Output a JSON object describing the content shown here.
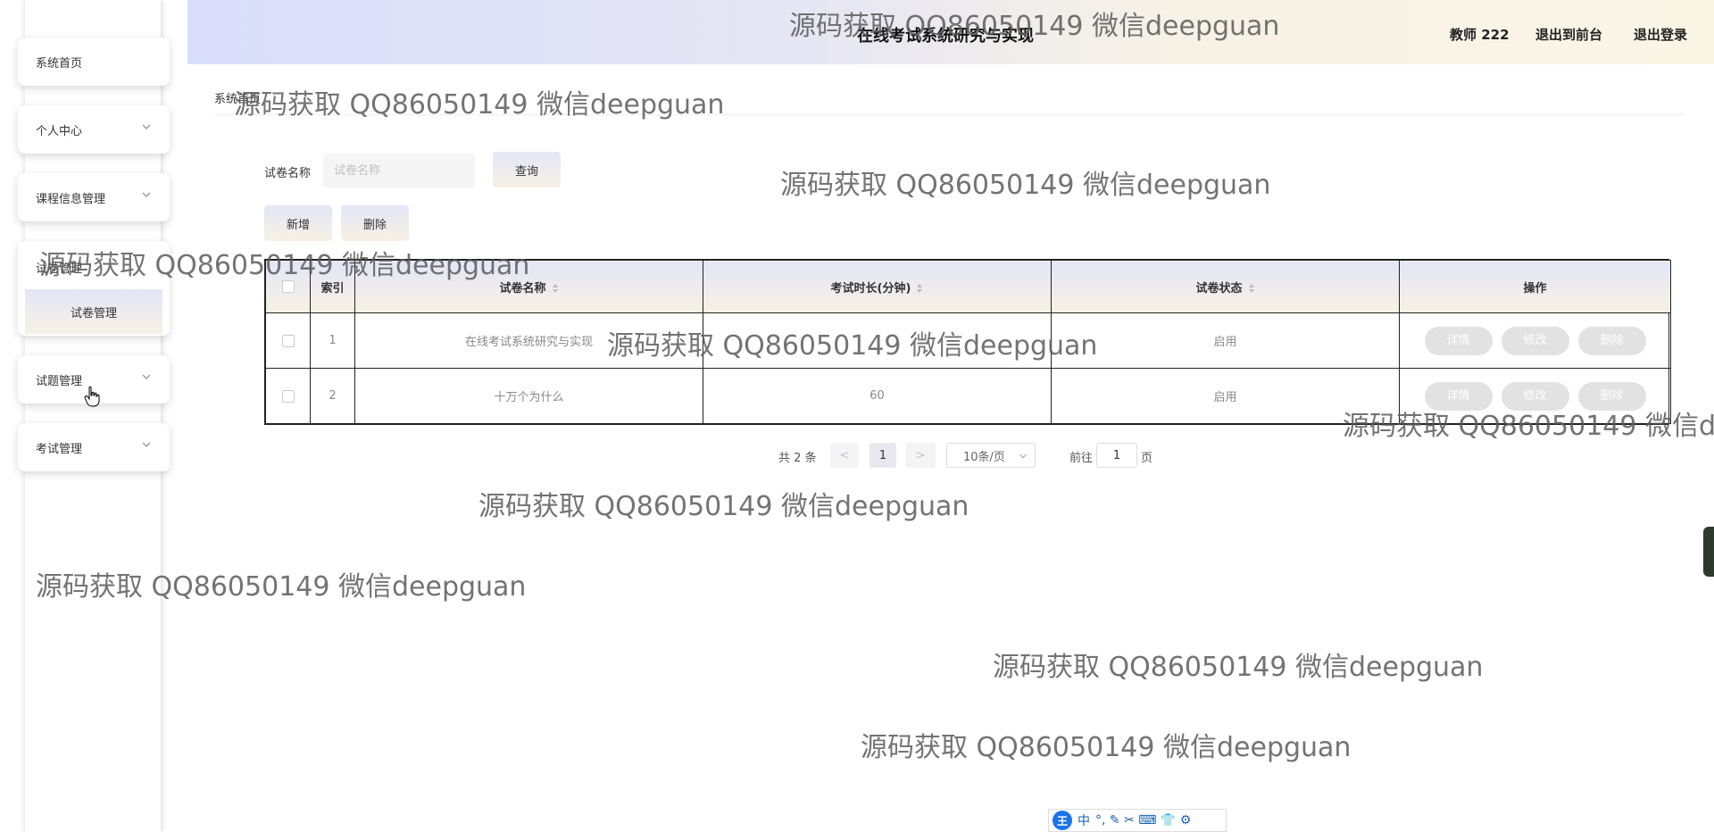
{
  "header": {
    "title": "在线考试系统研究与实现",
    "user": "教师 222",
    "front_link": "退出到前台",
    "logout_link": "退出登录"
  },
  "sidebar": {
    "items": [
      {
        "label": "系统首页",
        "icon": "none"
      },
      {
        "label": "个人中心",
        "icon": "chevron-down-icon"
      },
      {
        "label": "课程信息管理",
        "icon": "chevron-down-icon"
      },
      {
        "label": "试卷管理",
        "icon": "chevron-down-icon",
        "expanded": true,
        "children": [
          {
            "label": "试卷管理",
            "active": true
          }
        ]
      },
      {
        "label": "试题管理",
        "icon": "chevron-down-icon"
      },
      {
        "label": "考试管理",
        "icon": "chevron-down-icon"
      }
    ]
  },
  "breadcrumb": {
    "label": "系统首页"
  },
  "search": {
    "label": "试卷名称",
    "placeholder": "试卷名称",
    "button": "查询"
  },
  "actions": {
    "add": "新增",
    "delete": "删除"
  },
  "table": {
    "headers": [
      "索引",
      "试卷名称",
      "考试时长(分钟)",
      "试卷状态",
      "操作"
    ],
    "rows": [
      {
        "index": "1",
        "name": "在线考试系统研究与实现",
        "duration": "",
        "status": "启用"
      },
      {
        "index": "2",
        "name": "十万个为什么",
        "duration": "60",
        "status": "启用"
      }
    ],
    "row_buttons": {
      "detail": "详情",
      "edit": "修改",
      "delete": "删除"
    }
  },
  "pagination": {
    "total": "共 2 条",
    "prev": "<",
    "page": "1",
    "next": ">",
    "page_size": "10条/页",
    "goto_label": "前往",
    "goto_value": "1",
    "goto_unit": "页"
  },
  "watermark": "源码获取 QQ86050149 微信deepguan",
  "ime": {
    "logo": "王",
    "mode": "中",
    "glyphs": "°, ✎ ✂ ⌨ 👕 ⚙"
  },
  "colors": {
    "header_left": "#d9defa",
    "header_right": "#fbf5e6",
    "button_grad_top": "#e4e6f8",
    "button_grad_bottom": "#f6f1e4"
  }
}
